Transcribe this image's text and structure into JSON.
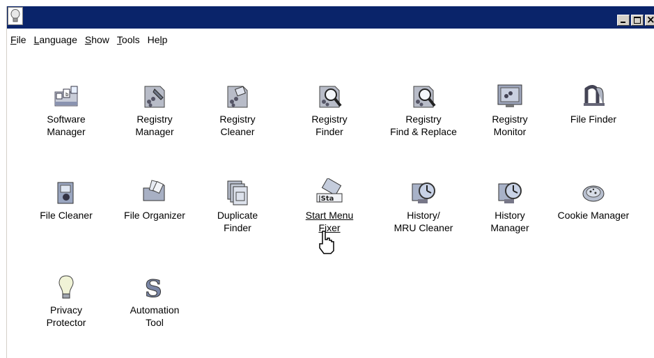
{
  "window": {
    "title": ""
  },
  "menu": [
    {
      "pre": "",
      "u": "F",
      "post": "ile"
    },
    {
      "pre": "",
      "u": "L",
      "post": "anguage"
    },
    {
      "pre": "",
      "u": "S",
      "post": "how"
    },
    {
      "pre": "",
      "u": "T",
      "post": "ools"
    },
    {
      "pre": "He",
      "u": "l",
      "post": "p"
    }
  ],
  "tools": [
    {
      "icon": "software-manager-icon",
      "line1": "Software",
      "line2": "Manager"
    },
    {
      "icon": "registry-manager-icon",
      "line1": "Registry",
      "line2": "Manager"
    },
    {
      "icon": "registry-cleaner-icon",
      "line1": "Registry",
      "line2": "Cleaner"
    },
    {
      "icon": "registry-finder-icon",
      "line1": "Registry",
      "line2": "Finder"
    },
    {
      "icon": "registry-find-replace-icon",
      "line1": "Registry",
      "line2": "Find & Replace"
    },
    {
      "icon": "registry-monitor-icon",
      "line1": "Registry",
      "line2": "Monitor"
    },
    {
      "icon": "file-finder-icon",
      "line1": "File Finder",
      "line2": ""
    },
    {
      "icon": "file-cleaner-icon",
      "line1": "File Cleaner",
      "line2": ""
    },
    {
      "icon": "file-organizer-icon",
      "line1": "File Organizer",
      "line2": ""
    },
    {
      "icon": "duplicate-finder-icon",
      "line1": "Duplicate",
      "line2": "Finder"
    },
    {
      "icon": "start-menu-fixer-icon",
      "line1": "Start Menu",
      "line2": "Fixer"
    },
    {
      "icon": "history-mru-cleaner-icon",
      "line1": "History/",
      "line2": "MRU Cleaner"
    },
    {
      "icon": "history-manager-icon",
      "line1": "History",
      "line2": "Manager"
    },
    {
      "icon": "cookie-manager-icon",
      "line1": "Cookie Manager",
      "line2": ""
    },
    {
      "icon": "privacy-protector-icon",
      "line1": "Privacy",
      "line2": "Protector"
    },
    {
      "icon": "automation-tool-icon",
      "line1": "Automation",
      "line2": "Tool"
    }
  ],
  "colors": {
    "titlebar": "#0a246a",
    "menu_bg": "#ffffff",
    "window_bg": "#ffffff"
  }
}
